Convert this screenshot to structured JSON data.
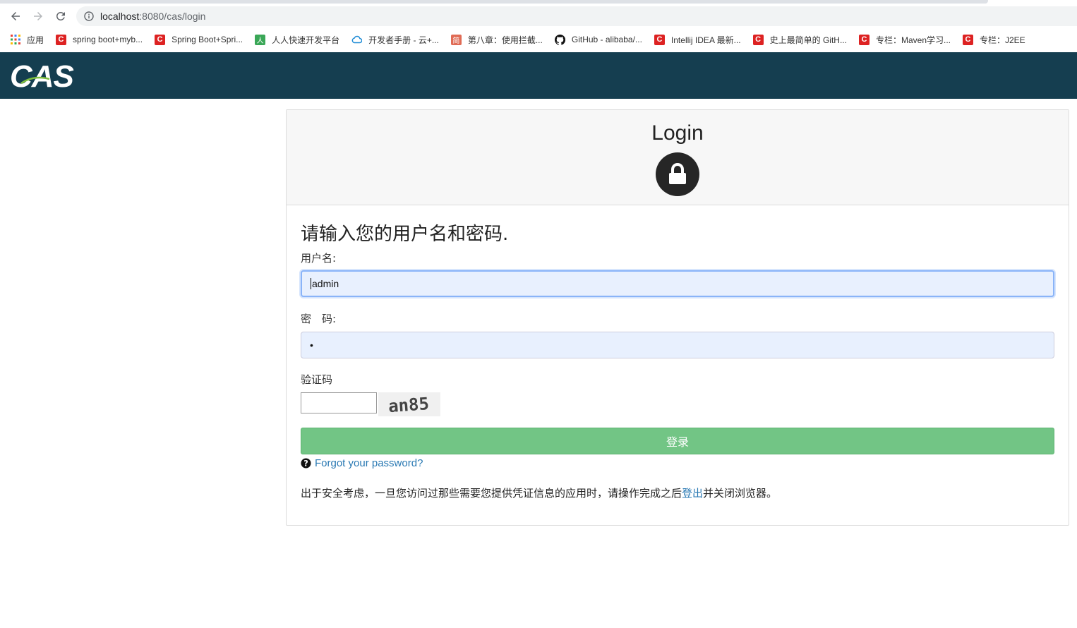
{
  "browser": {
    "url_host": "localhost",
    "url_path": ":8080/cas/login",
    "bookmarks": [
      {
        "label": "应用",
        "icon": "apps-grid-icon"
      },
      {
        "label": "spring boot+myb...",
        "icon": "csdn-icon"
      },
      {
        "label": "Spring Boot+Spri...",
        "icon": "csdn-icon"
      },
      {
        "label": "人人快速开发平台",
        "icon": "renren-icon"
      },
      {
        "label": "开发者手册 - 云+...",
        "icon": "cloud-icon"
      },
      {
        "label": "第八章：使用拦截...",
        "icon": "jianshu-icon"
      },
      {
        "label": "GitHub - alibaba/...",
        "icon": "github-icon"
      },
      {
        "label": "Intellij IDEA 最新...",
        "icon": "csdn-icon"
      },
      {
        "label": "史上最简单的 GitH...",
        "icon": "csdn-icon"
      },
      {
        "label": "专栏：Maven学习...",
        "icon": "csdn-icon"
      },
      {
        "label": "专栏：J2EE",
        "icon": "csdn-icon"
      }
    ]
  },
  "header": {
    "logo_text": "CAS",
    "bg_color": "#153e50"
  },
  "card": {
    "title": "Login",
    "prompt": "请输入您的用户名和密码.",
    "username_label": "用户名:",
    "username_value": "admin",
    "password_label": "密　码:",
    "password_value": "•",
    "captcha_label": "验证码",
    "captcha_text": "an85",
    "login_button": "登录",
    "forgot_link": "Forgot your password?",
    "notice_before": "出于安全考虑，一旦您访问过那些需要您提供凭证信息的应用时，请操作完成之后",
    "notice_link": "登出",
    "notice_after": "并关闭浏览器。",
    "button_color": "#72c585",
    "link_color": "#2a79b3"
  }
}
